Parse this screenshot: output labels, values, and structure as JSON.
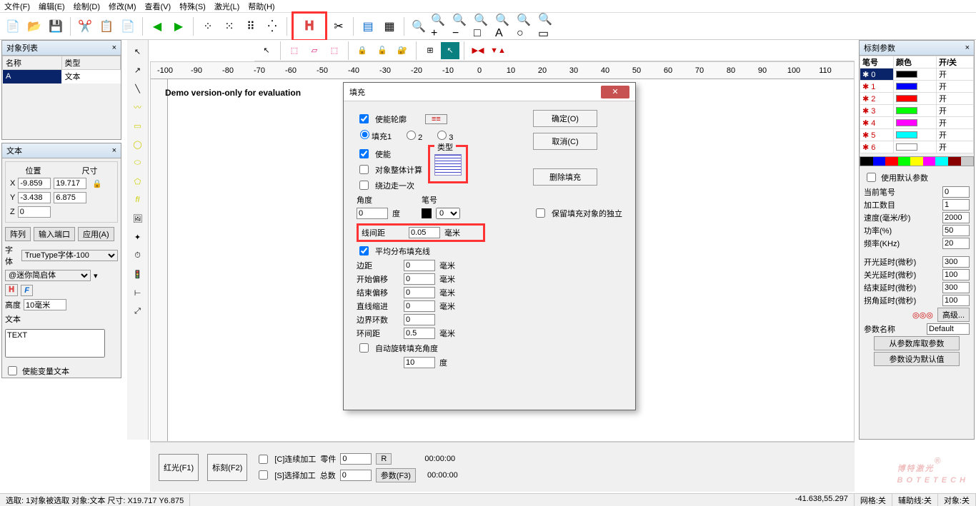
{
  "menu": {
    "items": [
      "文件(F)",
      "编辑(E)",
      "绘制(D)",
      "修改(M)",
      "查看(V)",
      "特殊(S)",
      "激光(L)",
      "帮助(H)"
    ]
  },
  "objList": {
    "title": "对象列表",
    "cols": [
      "名称",
      "类型"
    ],
    "rows": [
      {
        "name": "A",
        "type": "文本"
      }
    ]
  },
  "textPanel": {
    "title": "文本",
    "posLabel": "位置",
    "sizeLabel": "尺寸",
    "x": "-9.859",
    "w": "19.717",
    "y": "-3.438",
    "h": "6.875",
    "z": "0",
    "tabs": [
      "阵列",
      "输入端口",
      "应用(A)"
    ],
    "fontLabel": "字体",
    "font": "TrueType字体-100",
    "subfont": "@迷你简启体",
    "heightLabel": "高度",
    "height": "10毫米",
    "textLabel": "文本",
    "textVal": "TEXT",
    "varText": "使能变量文本"
  },
  "ruler": {
    "ticks": [
      "-100",
      "-90",
      "-80",
      "-70",
      "-60",
      "-50",
      "-40",
      "-30",
      "-20",
      "-10",
      "0",
      "10",
      "20",
      "30",
      "40",
      "50",
      "60",
      "70",
      "80",
      "90",
      "100",
      "110"
    ]
  },
  "demoText": "Demo version-only for evaluation",
  "dialog": {
    "title": "填充",
    "ok": "确定(O)",
    "cancel": "取消(C)",
    "delFill": "删除填充",
    "enableOutline": "使能轮廓",
    "fill1": "填充1",
    "enable": "使能",
    "wholeObj": "对象整体计算",
    "edgeOnce": "绕边走一次",
    "typeLabel": "类型",
    "angleLabel": "角度",
    "angleUnit": "度",
    "angleVal": "0",
    "penLabel": "笔号",
    "penVal": "0",
    "keepIndep": "保留填充对象的独立",
    "lineDistLabel": "线间距",
    "lineDist": "0.05",
    "lineDistUnit": "毫米",
    "avgFill": "平均分布填充线",
    "marginLabel": "边距",
    "margin": "0",
    "startOffLabel": "开始偏移",
    "startOff": "0",
    "endOffLabel": "结束偏移",
    "endOff": "0",
    "lineReduceLabel": "直线缩进",
    "lineReduce": "0",
    "loopLabel": "边界环数",
    "loop": "0",
    "loopDistLabel": "环间距",
    "loopDist": "0.5",
    "autoRotate": "自动旋转填充角度",
    "autoRotateVal": "10",
    "unitMm": "毫米",
    "unitDeg": "度"
  },
  "markPanel": {
    "title": "标刻参数",
    "penCols": [
      "笔号",
      "颜色",
      "开/关"
    ],
    "pens": [
      {
        "n": "0",
        "c": "#000000",
        "on": "开",
        "sel": true
      },
      {
        "n": "1",
        "c": "#0000ff",
        "on": "开"
      },
      {
        "n": "2",
        "c": "#ff0000",
        "on": "开"
      },
      {
        "n": "3",
        "c": "#00ff00",
        "on": "开"
      },
      {
        "n": "4",
        "c": "#ff00ff",
        "on": "开"
      },
      {
        "n": "5",
        "c": "#00ffff",
        "on": "开"
      },
      {
        "n": "6",
        "c": "#ffffff",
        "on": "开"
      }
    ],
    "useDefault": "使用默认参数",
    "curPen": "当前笔号",
    "curPenV": "0",
    "count": "加工数目",
    "countV": "1",
    "speed": "速度(毫米/秒)",
    "speedV": "2000",
    "power": "功率(%)",
    "powerV": "50",
    "freq": "频率(KHz)",
    "freqV": "20",
    "onDelay": "开光延时(微秒)",
    "onDelayV": "300",
    "offDelay": "关光延时(微秒)",
    "offDelayV": "100",
    "endDelay": "结束延时(微秒)",
    "endDelayV": "300",
    "cornerDelay": "拐角延时(微秒)",
    "cornerDelayV": "100",
    "advanced": "高级...",
    "paramName": "参数名称",
    "paramNameV": "Default",
    "loadFromLib": "从参数库取参数",
    "saveDefault": "参数设为默认值"
  },
  "bottom": {
    "red": "红光(F1)",
    "mark": "标刻(F2)",
    "cont": "[C]连续加工",
    "sel": "[S]选择加工",
    "parts": "零件",
    "partsV": "0",
    "r": "R",
    "total": "总数",
    "totalV": "0",
    "params": "参数(F3)",
    "t1": "00:00:00",
    "t2": "00:00:00"
  },
  "status": {
    "left": "选取: 1对象被选取 对象:文本 尺寸: X19.717 Y6.875",
    "coord": "-41.638,55.297",
    "grid": "网格:关",
    "aux": "辅助线:关",
    "obj": "对象:关"
  },
  "watermark": {
    "main": "博特激光",
    "sub": "BOTETECH",
    "r": "®"
  }
}
